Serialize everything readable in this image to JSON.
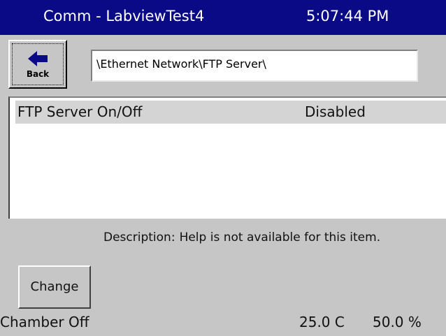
{
  "titlebar": {
    "title": "Comm - LabviewTest4",
    "time": "5:07:44 PM"
  },
  "back_button": {
    "label": "Back",
    "icon": "left-arrow-icon"
  },
  "path": "\\Ethernet Network\\FTP Server\\",
  "list": {
    "items": [
      {
        "label": "FTP Server On/Off",
        "value": "Disabled"
      }
    ]
  },
  "description": {
    "label": "Description:",
    "text": "Help is not available for this item."
  },
  "change_button": {
    "label": "Change"
  },
  "status_bar": {
    "chamber": "Chamber Off",
    "temperature": "25.0 C",
    "humidity": "50.0 %"
  },
  "colors": {
    "titlebar_bg": "#0a0a86",
    "window_bg": "#c6c6c6",
    "selected_row": "#d4d4d4"
  }
}
